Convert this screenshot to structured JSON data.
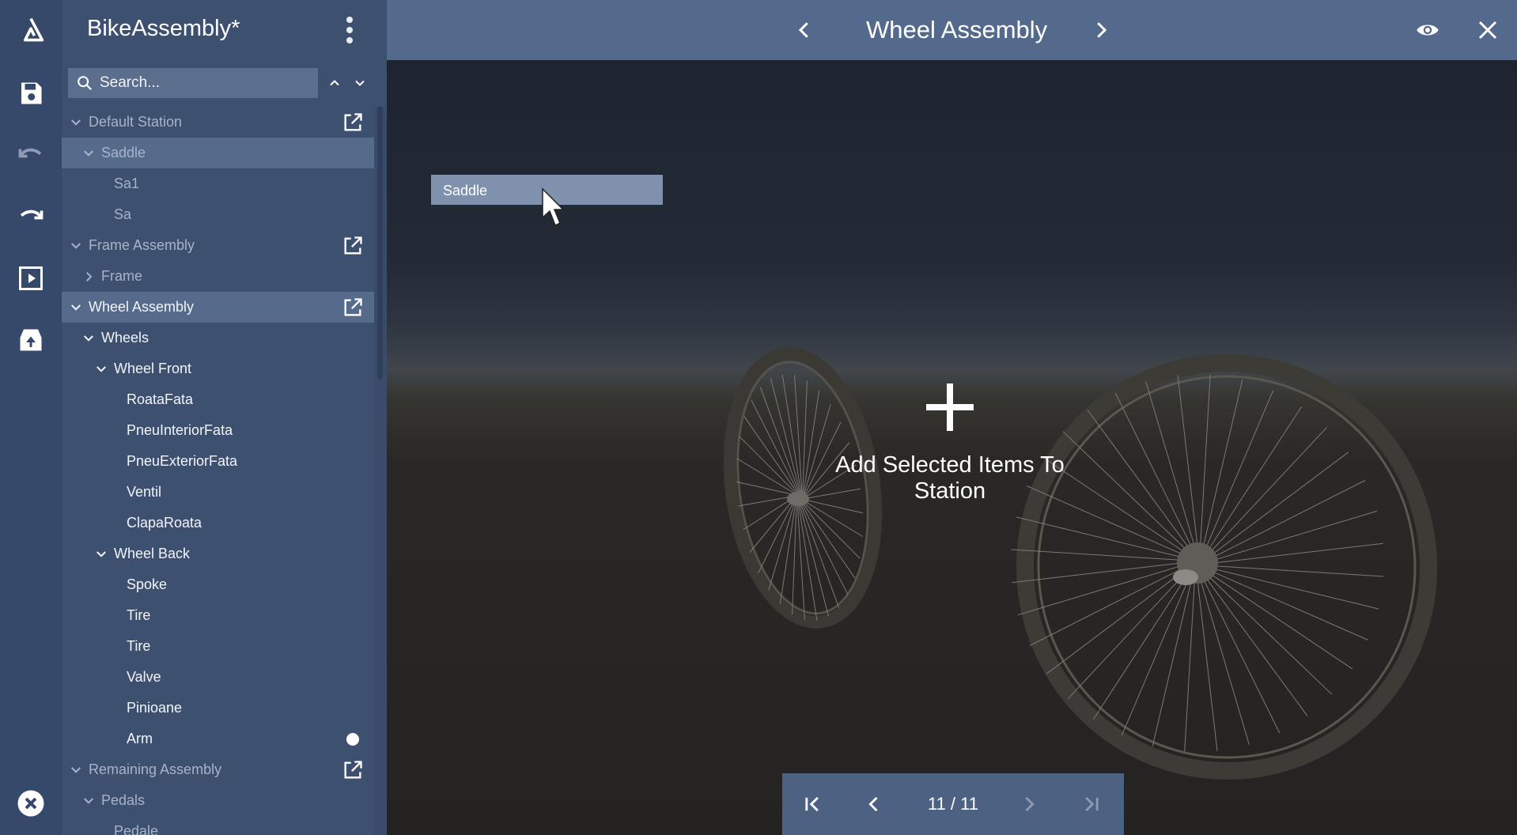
{
  "app": {
    "project_title": "BikeAssembly*",
    "rail": [
      "logo-icon",
      "save-icon",
      "undo-icon",
      "redo-icon",
      "play-icon",
      "upload-icon",
      "close-circle-icon"
    ]
  },
  "search": {
    "placeholder": "Search..."
  },
  "tree": {
    "items": [
      {
        "label": "Default Station",
        "depth": 0,
        "expander": "expanded",
        "dim": true,
        "external": true
      },
      {
        "label": "Saddle",
        "depth": 1,
        "expander": "expanded",
        "dim": true,
        "selected": true
      },
      {
        "label": "Sa1",
        "depth": 2,
        "expander": "none",
        "dim": true
      },
      {
        "label": "Sa",
        "depth": 2,
        "expander": "none",
        "dim": true
      },
      {
        "label": "Frame Assembly",
        "depth": 0,
        "expander": "expanded",
        "dim": true,
        "external": true
      },
      {
        "label": "Frame",
        "depth": 1,
        "expander": "collapsed",
        "dim": true
      },
      {
        "label": "Wheel Assembly",
        "depth": 0,
        "expander": "expanded",
        "selected": true,
        "external": true
      },
      {
        "label": "Wheels",
        "depth": 1,
        "expander": "expanded"
      },
      {
        "label": "Wheel Front",
        "depth": 2,
        "expander": "expanded"
      },
      {
        "label": "RoataFata",
        "depth": 3,
        "expander": "none"
      },
      {
        "label": "PneuInteriorFata",
        "depth": 3,
        "expander": "none"
      },
      {
        "label": "PneuExteriorFata",
        "depth": 3,
        "expander": "none"
      },
      {
        "label": "Ventil",
        "depth": 3,
        "expander": "none"
      },
      {
        "label": "ClapaRoata",
        "depth": 3,
        "expander": "none"
      },
      {
        "label": "Wheel Back",
        "depth": 2,
        "expander": "expanded"
      },
      {
        "label": "Spoke",
        "depth": 3,
        "expander": "none"
      },
      {
        "label": "Tire",
        "depth": 3,
        "expander": "none"
      },
      {
        "label": "Tire",
        "depth": 3,
        "expander": "none"
      },
      {
        "label": "Valve",
        "depth": 3,
        "expander": "none"
      },
      {
        "label": "Pinioane",
        "depth": 3,
        "expander": "none"
      },
      {
        "label": "Arm",
        "depth": 3,
        "expander": "none",
        "dot": true
      },
      {
        "label": "Remaining Assembly",
        "depth": 0,
        "expander": "expanded",
        "dim": true,
        "external": true
      },
      {
        "label": "Pedals",
        "depth": 1,
        "expander": "expanded",
        "dim": true
      },
      {
        "label": "Pedale",
        "depth": 2,
        "expander": "none",
        "dim": true
      }
    ]
  },
  "topbar": {
    "station_title": "Wheel Assembly",
    "icons": [
      "chevron-left-icon",
      "chevron-right-icon",
      "eye-icon",
      "close-icon"
    ]
  },
  "viewport": {
    "drag_item": "Saddle",
    "drop_hint": "Add Selected Items To Station"
  },
  "pager": {
    "counter": "11 / 11",
    "icons": [
      "first-page-icon",
      "prev-page-icon",
      "next-page-icon",
      "last-page-icon"
    ]
  },
  "colors": {
    "rail": "#36496b",
    "panel": "#3e5070",
    "topbar": "#546a8c",
    "selected_row": "#566b8c",
    "drag_tag": "#7f91ad",
    "pager": "#4d6283"
  }
}
